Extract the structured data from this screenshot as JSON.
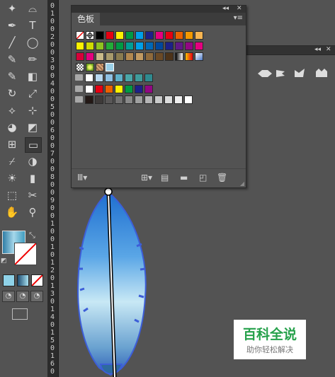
{
  "swatches_panel": {
    "title": "色板",
    "collapse_label": "◂◂",
    "close_label": "✕",
    "menu_label": "▾≡",
    "rows": [
      [
        "#ffffff",
        "#ffffff",
        "#000000",
        "#e60012",
        "#fff100",
        "#009944",
        "#00a0e9",
        "#1d2088",
        "#e4007f",
        "#e60012",
        "#eb6100",
        "#f39800",
        "#f8b551"
      ],
      [
        "#fff100",
        "#cfdb00",
        "#8fc31f",
        "#22ac38",
        "#009944",
        "#009e96",
        "#00a0e9",
        "#0068b7",
        "#00479d",
        "#1d2088",
        "#601986",
        "#920783",
        "#e4007f"
      ],
      [
        "#d7003a",
        "#e4007f",
        "#c9ba8a",
        "#a89a6c",
        "#8a7b50",
        "#b28850",
        "#c29a62",
        "#8f6a3c",
        "#6b4a26",
        "#4d3319",
        "#f4c300",
        "#ff8c00",
        "#a0c8ff"
      ],
      [
        "#fafafa",
        "#8fc31f",
        "#c8a070",
        "#9ad0e8"
      ],
      [
        "#ffffff",
        "#b8d8ef",
        "#8fc1e3",
        "#5fb0c9",
        "#4aa6a8",
        "#3f9b9b",
        "#2f8a8f"
      ],
      [
        "#ffffff",
        "#e60012",
        "#eb6100",
        "#fff100",
        "#009944",
        "#1d2088",
        "#920783"
      ],
      [
        "#231815",
        "#3e3a39",
        "#595757",
        "#727171",
        "#898989",
        "#9fa0a0",
        "#b5b5b6",
        "#c9caca",
        "#dcdddd",
        "#efefef",
        "#ffffff"
      ]
    ]
  },
  "tools": [
    "magic-wand-icon",
    "lasso-icon",
    "pen-icon",
    "type-icon",
    "line-icon",
    "ellipse-icon",
    "paintbrush-icon",
    "pencil-icon",
    "blob-brush-icon",
    "eraser-icon",
    "rotate-icon",
    "scale-icon",
    "width-icon",
    "free-transform-icon",
    "shape-builder-icon",
    "perspective-icon",
    "mesh-icon",
    "gradient-icon",
    "eyedropper-icon",
    "blend-icon",
    "symbol-sprayer-icon",
    "column-graph-icon",
    "artboard-icon",
    "slice-icon",
    "hand-icon",
    "zoom-icon"
  ],
  "tool_glyphs": [
    "✦",
    "⌓",
    "✒",
    "T",
    "╱",
    "◯",
    "✎",
    "✏",
    "✎",
    "◧",
    "↻",
    "⤢",
    "⟡",
    "⊹",
    "◕",
    "◩",
    "⊞",
    "▭",
    "⌿",
    "◑",
    "☀",
    "▮",
    "⬚",
    "✂",
    "✋",
    "⚲"
  ],
  "ruler_digits": [
    "0",
    "1",
    "0",
    "0",
    "2",
    "0",
    "0",
    "3",
    "0",
    "0",
    "4",
    "0",
    "0",
    "5",
    "0",
    "0",
    "6",
    "0",
    "0",
    "7",
    "0",
    "0",
    "8",
    "0",
    "0",
    "9",
    "0",
    "0",
    "1",
    "0",
    "0",
    "1",
    "0",
    "1",
    "2",
    "0",
    "1",
    "3",
    "0",
    "1",
    "4",
    "0",
    "1",
    "5",
    "0",
    "1",
    "6",
    "0"
  ],
  "watermark": {
    "line1": "百科全说",
    "line2": "助你轻松解决"
  },
  "colors": {
    "background": "#535353",
    "panel_bar": "#323232",
    "watermark_green": "#26a14b"
  }
}
